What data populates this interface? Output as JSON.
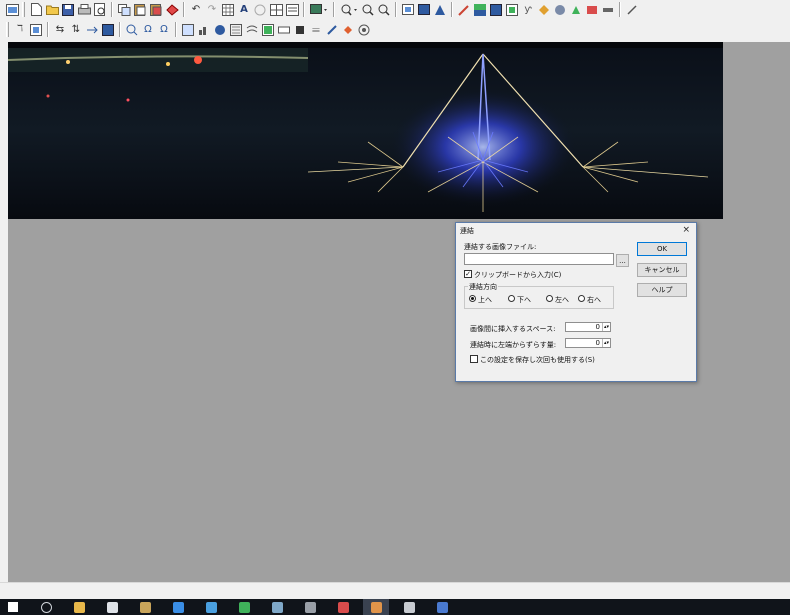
{
  "toolbar1": {
    "icons": [
      "new-image-icon",
      "new-file-icon",
      "open-icon",
      "save-icon",
      "print-icon",
      "print-preview-icon",
      "copy-icon",
      "paste-icon",
      "paste-new-icon",
      "paste-special-icon",
      "undo-icon",
      "redo-icon",
      "grid-icon",
      "text-icon",
      "circle-icon",
      "grid-view-icon",
      "thumbnail-icon",
      "display-icon",
      "zoom-dropdown-icon",
      "zoom-in-icon",
      "zoom-out-icon",
      "frame-icon",
      "color-icon",
      "palette-icon",
      "brush-icon",
      "fill-icon",
      "image-icon",
      "effect-icon",
      "stamp-icon",
      "plugin-icon",
      "screen-icon",
      "pen-icon"
    ]
  },
  "toolbar2": {
    "icons": [
      "align-icon",
      "resize-icon",
      "flip-h-icon",
      "flip-v-icon",
      "rotate-icon",
      "color-adjust-icon",
      "sharpen-icon",
      "blur-icon",
      "filter-icon",
      "mosaic-icon",
      "histogram-icon",
      "gradient-icon",
      "noise-icon",
      "frame-border-icon",
      "box-icon",
      "wave-icon",
      "pen-tool-icon",
      "bucket-icon",
      "target-icon"
    ]
  },
  "dialog": {
    "title": "連結",
    "close": "×",
    "file_label": "連結する画像ファイル:",
    "file_value": "",
    "browse": "...",
    "clipboard_checkbox": "クリップボードから入力(C)",
    "clipboard_checked": true,
    "direction_group": "連結方向",
    "directions": [
      "上へ",
      "下へ",
      "左へ",
      "右へ"
    ],
    "direction_selected": 0,
    "space_label": "画像間に挿入するスペース:",
    "space_value": "0",
    "shift_label": "連結時に左端からずらす量:",
    "shift_value": "0",
    "save_checkbox": "この設定を保存し次回も使用する(S)",
    "save_checked": false,
    "ok": "OK",
    "cancel": "キャンセル",
    "help": "ヘルプ"
  },
  "taskbar": {
    "icons": [
      "windows-start-icon",
      "task-view-icon",
      "file-explorer-icon",
      "store-icon",
      "app-icon",
      "edge-icon",
      "mail-icon",
      "photos-icon",
      "app2-icon",
      "settings-icon",
      "media-icon",
      "image-editor-icon",
      "player-icon",
      "spreadsheet-icon"
    ],
    "colors": [
      "#ffffff",
      "#cfd4da",
      "#e8b84a",
      "#dfe3e8",
      "#c8a45a",
      "#3a8ee6",
      "#4aa0e0",
      "#3fb25a",
      "#7fa8c8",
      "#9aa0a8",
      "#d94c4c",
      "#e0944a",
      "#c8ccd2",
      "#4a7ad0"
    ]
  }
}
